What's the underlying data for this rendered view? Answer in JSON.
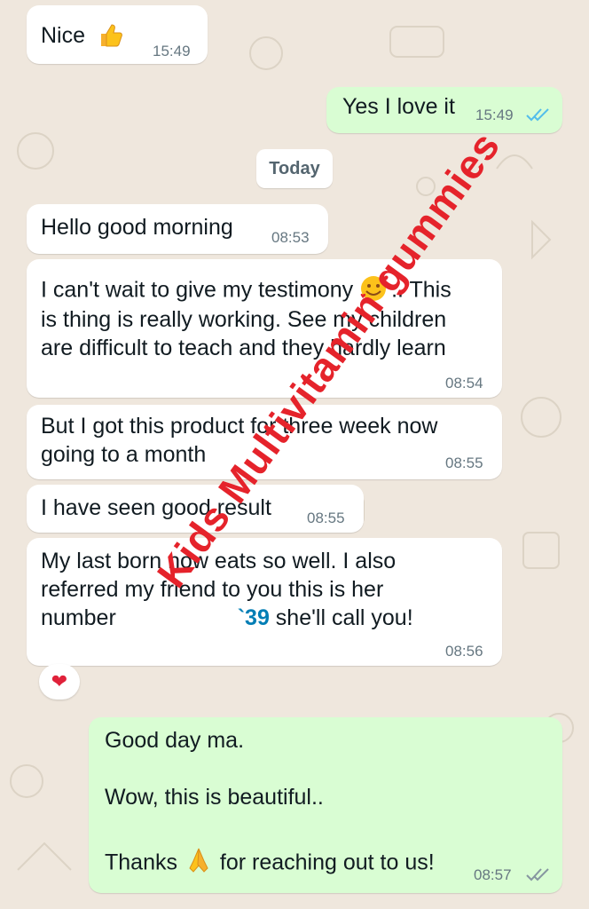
{
  "messages": [
    {
      "id": "m1",
      "dir": "in",
      "text": "Nice",
      "emoji": "thumbs-up",
      "time": "15:49"
    },
    {
      "id": "m2",
      "dir": "out",
      "text": "Yes I love it",
      "time": "15:49",
      "status": "read"
    },
    {
      "id": "m3",
      "dir": "in",
      "text": "Hello good morning",
      "time": "08:53"
    },
    {
      "id": "m4",
      "dir": "in",
      "lines": [
        "I can't wait to give my testimony",
        "is thing is really working. See my children",
        "are difficult to teach and they hardly learn"
      ],
      "line1_suffix": ".. This",
      "emoji": "smiling-face-with-hearts",
      "time": "08:54"
    },
    {
      "id": "m5",
      "dir": "in",
      "lines": [
        "But I got this product for three week now",
        "going to a month"
      ],
      "time": "08:55"
    },
    {
      "id": "m6",
      "dir": "in",
      "text": "I have seen good result",
      "time": "08:55"
    },
    {
      "id": "m7",
      "dir": "in",
      "lines": [
        "My last born now eats so well. I also",
        "referred my friend to you this is her"
      ],
      "line3_prefix": "number",
      "phone_tail": "`39",
      "line3_suffix": " she'll call you!",
      "time": "08:56",
      "reaction": "❤"
    },
    {
      "id": "m8",
      "dir": "out",
      "lines": [
        "Good day ma.",
        "Wow, this is beautiful.."
      ],
      "thanks_prefix": "Thanks",
      "thanks_suffix": "for reaching out to us!",
      "emoji": "folded-hands",
      "time": "08:57",
      "status": "delivered"
    }
  ],
  "day_divider": "Today",
  "watermark": "Kids Multivitamin gummies",
  "colors": {
    "incoming": "#ffffff",
    "outgoing": "#d9fdd3",
    "wallpaper": "#efe7dd",
    "read_ticks": "#53bdeb",
    "watermark": "#e5232b"
  }
}
